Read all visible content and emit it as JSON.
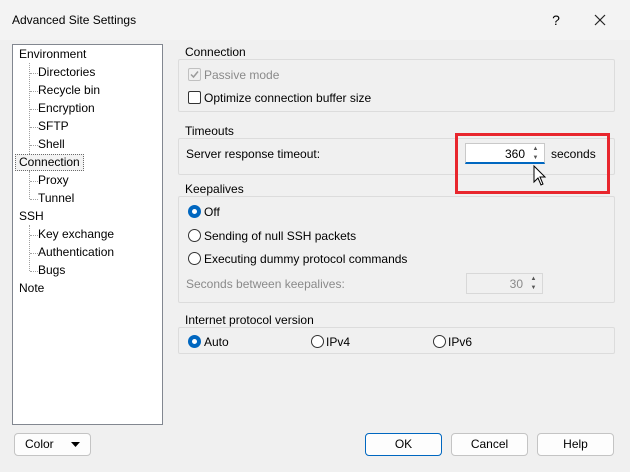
{
  "window": {
    "title": "Advanced Site Settings",
    "help": "?"
  },
  "tree": {
    "items": [
      {
        "label": "Environment"
      },
      {
        "label": "Directories"
      },
      {
        "label": "Recycle bin"
      },
      {
        "label": "Encryption"
      },
      {
        "label": "SFTP"
      },
      {
        "label": "Shell"
      },
      {
        "label": "Connection"
      },
      {
        "label": "Proxy"
      },
      {
        "label": "Tunnel"
      },
      {
        "label": "SSH"
      },
      {
        "label": "Key exchange"
      },
      {
        "label": "Authentication"
      },
      {
        "label": "Bugs"
      },
      {
        "label": "Note"
      }
    ]
  },
  "connection": {
    "title": "Connection",
    "passive_mode": "Passive mode",
    "optimize_buffer": "Optimize connection buffer size"
  },
  "timeouts": {
    "title": "Timeouts",
    "server_response_label": "Server response timeout:",
    "value": "360",
    "unit": "seconds"
  },
  "keepalives": {
    "title": "Keepalives",
    "off": "Off",
    "null_packets": "Sending of null SSH packets",
    "dummy_commands": "Executing dummy protocol commands",
    "seconds_label": "Seconds between keepalives:",
    "seconds_value": "30"
  },
  "ip_version": {
    "title": "Internet protocol version",
    "auto": "Auto",
    "ipv4": "IPv4",
    "ipv6": "IPv6"
  },
  "buttons": {
    "color": "Color",
    "ok": "OK",
    "cancel": "Cancel",
    "help": "Help"
  }
}
